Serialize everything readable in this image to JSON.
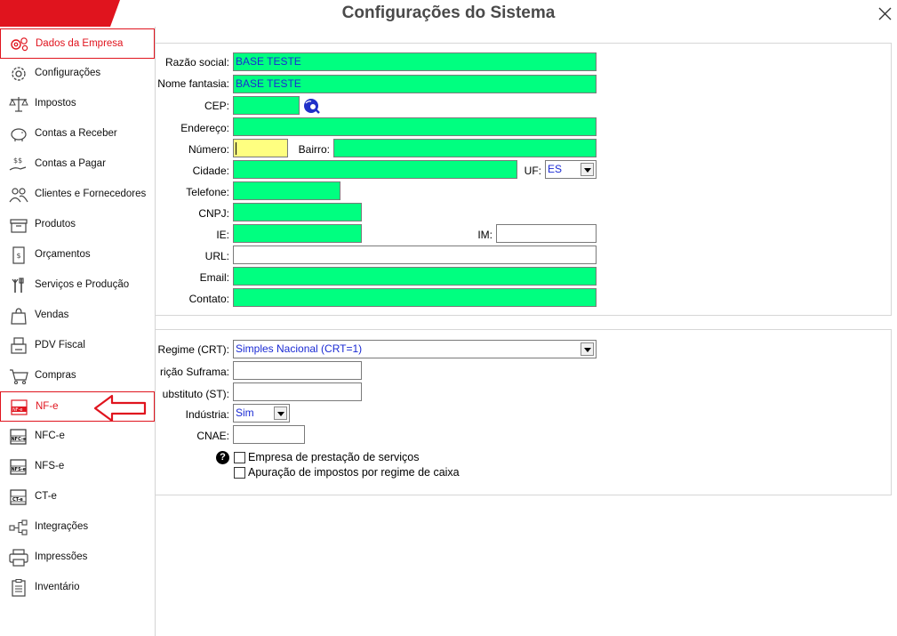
{
  "window": {
    "title": "Configurações do Sistema"
  },
  "sidebar": {
    "items": [
      {
        "label": "Dados da Empresa"
      },
      {
        "label": "Configurações"
      },
      {
        "label": "Impostos"
      },
      {
        "label": "Contas a Receber"
      },
      {
        "label": "Contas a Pagar"
      },
      {
        "label": "Clientes e Fornecedores"
      },
      {
        "label": "Produtos"
      },
      {
        "label": "Orçamentos"
      },
      {
        "label": "Serviços e Produção"
      },
      {
        "label": "Vendas"
      },
      {
        "label": "PDV Fiscal"
      },
      {
        "label": "Compras"
      },
      {
        "label": "NF-e"
      },
      {
        "label": "NFC-e"
      },
      {
        "label": "NFS-e"
      },
      {
        "label": "CT-e"
      },
      {
        "label": "Integrações"
      },
      {
        "label": "Impressões"
      },
      {
        "label": "Inventário"
      }
    ],
    "icon_texts": {
      "nfe": "NF-e",
      "nfce": "NFC-e",
      "nfse": "NFS-e",
      "cte": "CT-e",
      "dollar": "$",
      "dollars": "$$"
    }
  },
  "company": {
    "razao_social_label": "Razão social:",
    "razao_social_value": "BASE TESTE",
    "nome_fantasia_label": "Nome fantasia:",
    "nome_fantasia_value": "BASE TESTE",
    "cep_label": "CEP:",
    "cep_value": "",
    "endereco_label": "Endereço:",
    "endereco_value": "",
    "numero_label": "Número:",
    "numero_value": "",
    "bairro_label": "Bairro:",
    "bairro_value": "",
    "cidade_label": "Cidade:",
    "cidade_value": "",
    "uf_label": "UF:",
    "uf_value": "ES",
    "telefone_label": "Telefone:",
    "telefone_value": "",
    "cnpj_label": "CNPJ:",
    "cnpj_value": "",
    "ie_label": "IE:",
    "ie_value": "",
    "im_label": "IM:",
    "im_value": "",
    "url_label": "URL:",
    "url_value": "",
    "email_label": "Email:",
    "email_value": "",
    "contato_label": "Contato:",
    "contato_value": ""
  },
  "fiscal": {
    "regime_label": "Regime (CRT):",
    "regime_value": "Simples Nacional (CRT=1)",
    "suframa_label": "rição Suframa:",
    "suframa_value": "",
    "st_label": "ubstituto (ST):",
    "st_value": "",
    "industria_label": "Indústria:",
    "industria_value": "Sim",
    "cnae_label": "CNAE:",
    "cnae_value": "",
    "help_glyph": "?",
    "servicos_label": "Empresa de prestação de serviços",
    "servicos_checked": false,
    "caixa_label": "Apuração de impostos por regime de caixa",
    "caixa_checked": false
  },
  "colors": {
    "brand_red": "#e0141e",
    "required_green": "#00ff80",
    "focus_yellow": "#ffff80",
    "value_blue": "#1a2ad4"
  }
}
